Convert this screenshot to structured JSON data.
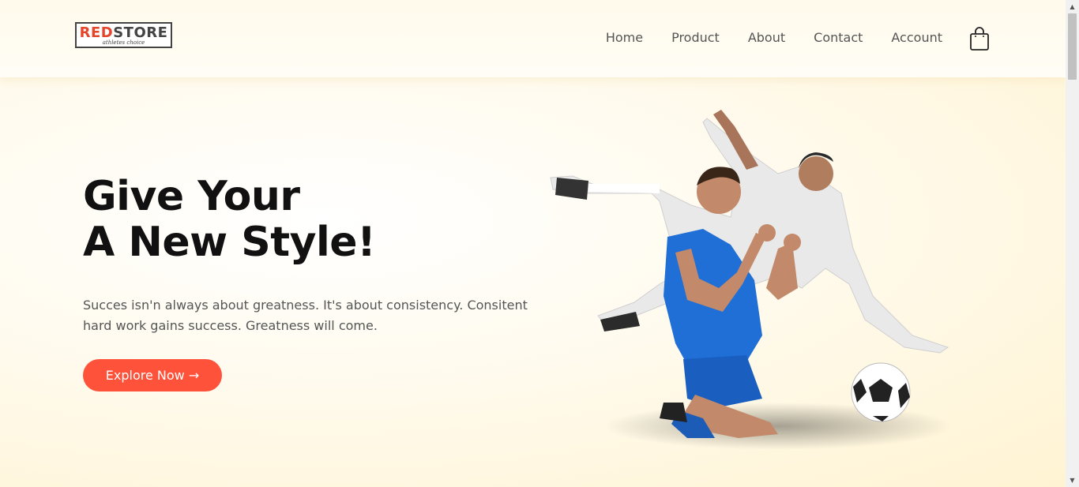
{
  "header": {
    "logo": {
      "brand_red": "RED",
      "brand_dark": "STORE",
      "tagline": "athletes choice"
    },
    "nav": [
      {
        "label": "Home"
      },
      {
        "label": "Product"
      },
      {
        "label": "About"
      },
      {
        "label": "Contact"
      },
      {
        "label": "Account"
      }
    ],
    "cart_icon": "shopping-bag-icon"
  },
  "hero": {
    "title_line1": "Give Your",
    "title_line2": "A New Style!",
    "description": "Succes isn'n always about greatness. It's about consistency. Consitent hard work gains success. Greatness will come.",
    "cta_label": "Explore Now →",
    "image": "soccer-players-celebrating"
  },
  "colors": {
    "accent": "#ff523b",
    "background": "#fff5d6",
    "text_dark": "#111111",
    "text_body": "#555555"
  }
}
